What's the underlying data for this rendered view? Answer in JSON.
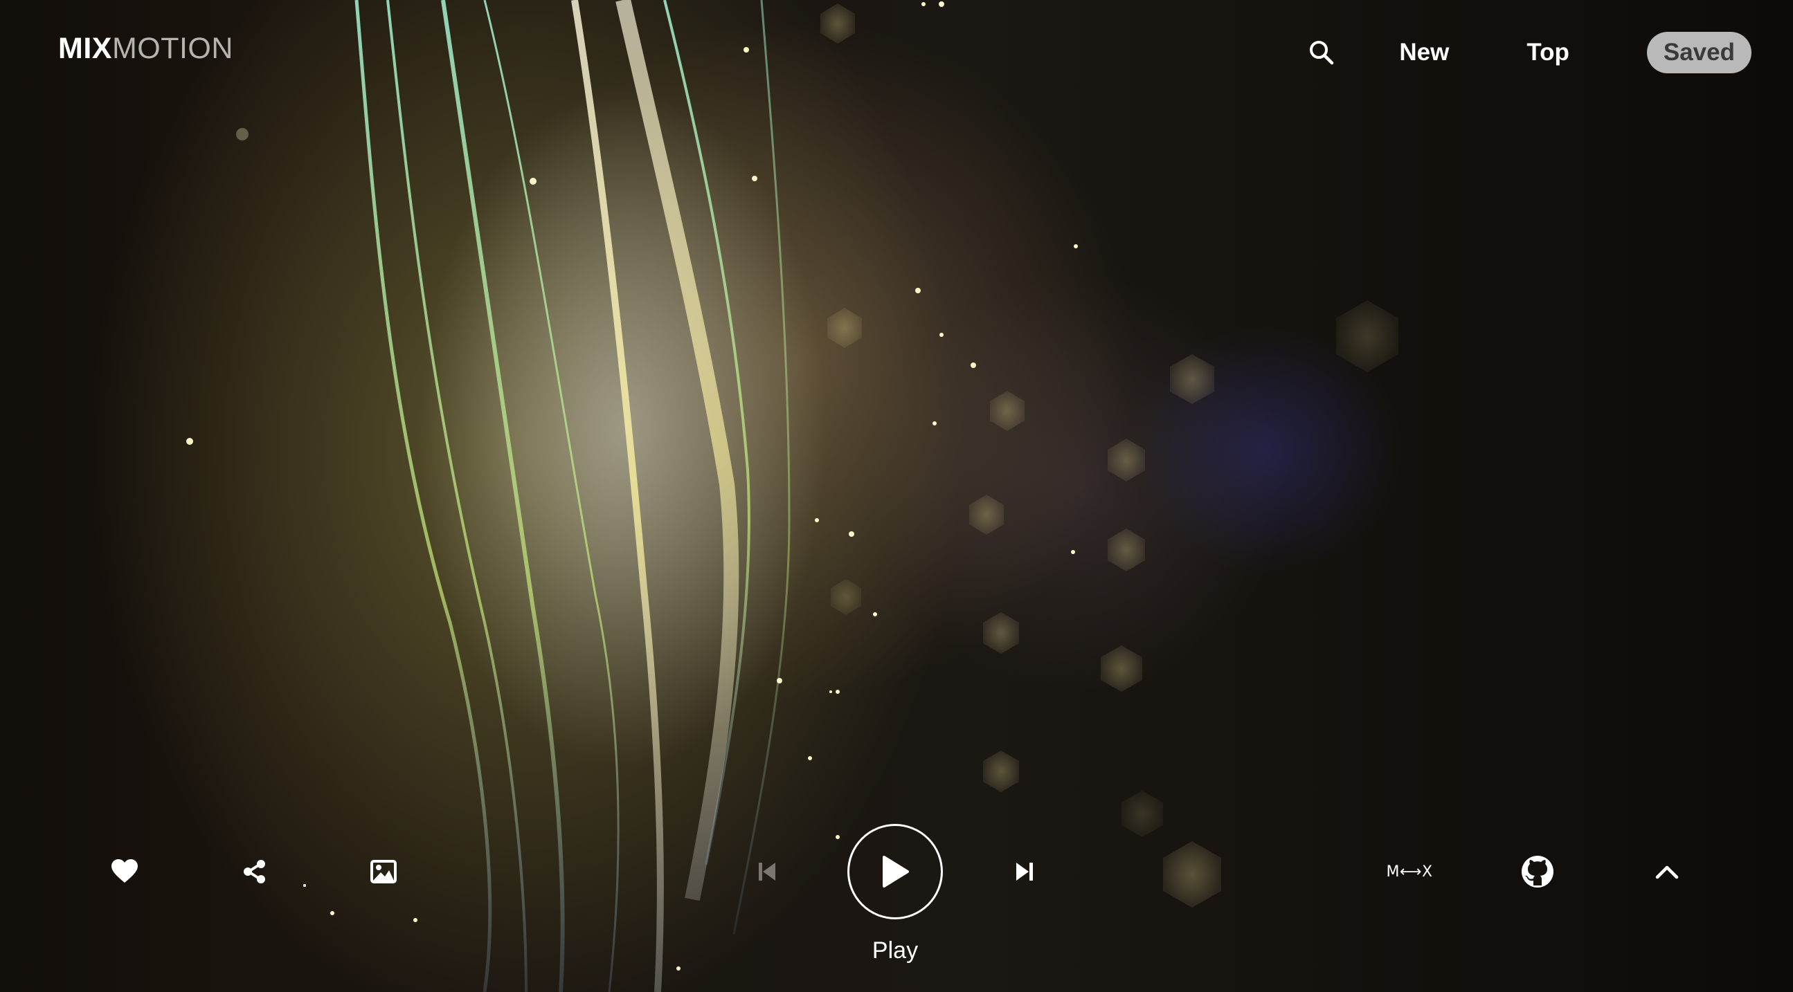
{
  "header": {
    "logo_bold": "MIX",
    "logo_light": "MOTION",
    "nav": {
      "search_icon": "search-icon",
      "new_label": "New",
      "top_label": "Top",
      "saved_label": "Saved"
    }
  },
  "player": {
    "play_label": "Play",
    "mx_label": "M⟷X",
    "icons": {
      "like": "heart-icon",
      "share": "share-icon",
      "image": "image-icon",
      "previous": "skip-previous-icon",
      "play": "play-icon",
      "next": "skip-next-icon",
      "github": "github-icon",
      "expand": "chevron-up-icon"
    }
  },
  "colors": {
    "accent_text": "#ffffff",
    "logo_light": "#b7b3ad",
    "saved_pill_bg": "#b9b9b9",
    "saved_pill_text": "#3a3a3a"
  }
}
